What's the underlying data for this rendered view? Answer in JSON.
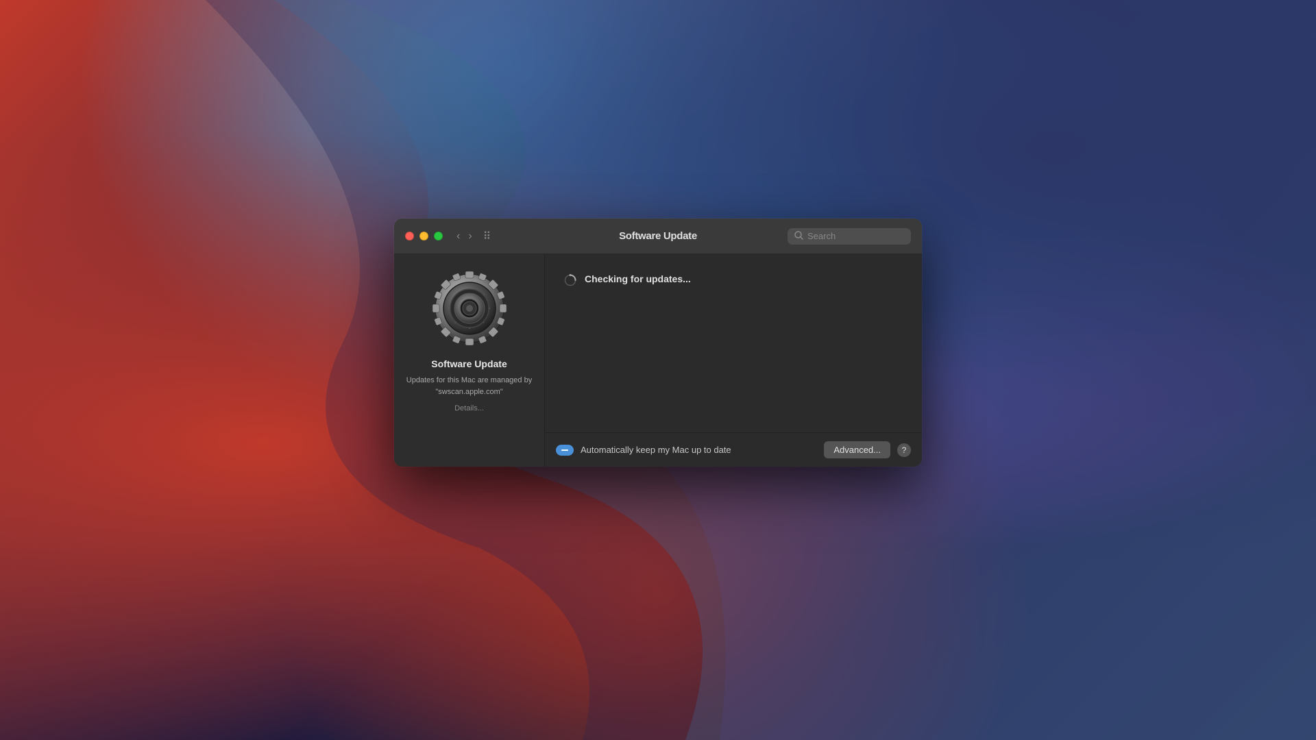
{
  "desktop": {
    "bg_colors": [
      "#c0392b",
      "#1a1a3e",
      "#8e44ad",
      "#2471a3"
    ]
  },
  "window": {
    "title": "Software Update",
    "traffic_lights": {
      "close_label": "close",
      "minimize_label": "minimize",
      "zoom_label": "zoom"
    },
    "nav": {
      "back_label": "‹",
      "forward_label": "›",
      "grid_label": "⊞"
    },
    "search": {
      "placeholder": "Search"
    },
    "sidebar": {
      "icon_alt": "Software Update gear icon",
      "title": "Software Update",
      "description": "Updates for this Mac are managed by \"swscan.apple.com\"",
      "details_link": "Details..."
    },
    "main": {
      "checking_text": "Checking for updates...",
      "auto_update_label": "Automatically keep my Mac up to date",
      "advanced_button": "Advanced...",
      "help_button": "?"
    }
  }
}
